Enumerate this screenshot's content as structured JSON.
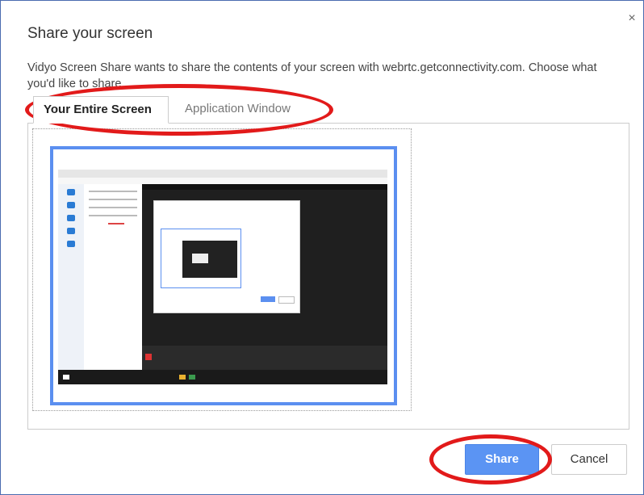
{
  "dialog": {
    "title": "Share your screen",
    "description": "Vidyo Screen Share wants to share the contents of your screen with webrtc.getconnectivity.com. Choose what you'd like to share.",
    "close_label": "×"
  },
  "tabs": [
    {
      "label": "Your Entire Screen",
      "selected": true
    },
    {
      "label": "Application Window",
      "selected": false
    }
  ],
  "buttons": {
    "share_label": "Share",
    "cancel_label": "Cancel"
  },
  "colors": {
    "accent": "#5b94f3",
    "selection_border": "#5b8ff0",
    "annotation_ring": "#e21a1a",
    "frame_border": "#4a6bb0"
  },
  "icons": {
    "close": "close-icon"
  }
}
